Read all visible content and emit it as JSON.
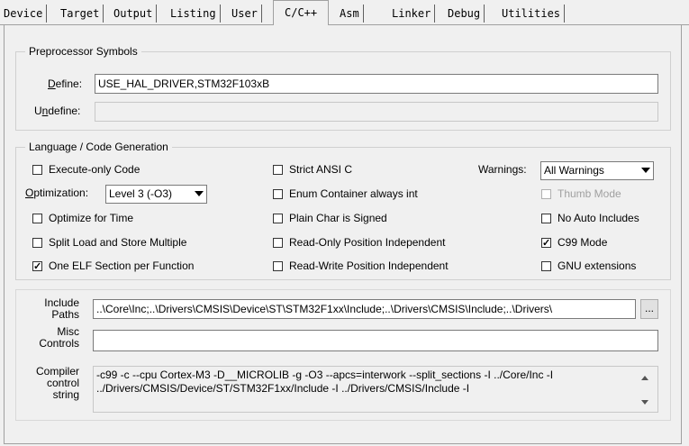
{
  "tabs": [
    "Device",
    "Target",
    "Output",
    "Listing",
    "User",
    "C/C++",
    "Asm",
    "Linker",
    "Debug",
    "Utilities"
  ],
  "active_tab": "C/C++",
  "preprocessor": {
    "legend": "Preprocessor Symbols",
    "define_label": "Define:",
    "define_value": "USE_HAL_DRIVER,STM32F103xB",
    "undefine_label": "Undefine:",
    "undefine_value": ""
  },
  "language": {
    "legend": "Language / Code Generation",
    "execute_only": {
      "label": "Execute-only Code",
      "checked": false
    },
    "optimization_label": "Optimization:",
    "optimization_value": "Level 3 (-O3)",
    "optimize_time": {
      "label": "Optimize for Time",
      "checked": false
    },
    "split_load": {
      "label": "Split Load and Store Multiple",
      "checked": false
    },
    "one_elf": {
      "label": "One ELF Section per Function",
      "checked": true
    },
    "strict_ansi": {
      "label": "Strict ANSI C",
      "checked": false
    },
    "enum_container": {
      "label": "Enum Container always int",
      "checked": false
    },
    "plain_char": {
      "label": "Plain Char is Signed",
      "checked": false
    },
    "ropi": {
      "label": "Read-Only Position Independent",
      "checked": false
    },
    "rwpi": {
      "label": "Read-Write Position Independent",
      "checked": false
    },
    "warnings_label": "Warnings:",
    "warnings_value": "All Warnings",
    "thumb_mode": {
      "label": "Thumb Mode",
      "checked": false,
      "disabled": true
    },
    "no_auto_includes": {
      "label": "No Auto Includes",
      "checked": false
    },
    "c99_mode": {
      "label": "C99 Mode",
      "checked": true
    },
    "gnu_extensions": {
      "label": "GNU extensions",
      "checked": false
    }
  },
  "include_paths": {
    "label_line1": "Include",
    "label_line2": "Paths",
    "value": "..\\Core\\Inc;..\\Drivers\\CMSIS\\Device\\ST\\STM32F1xx\\Include;..\\Drivers\\CMSIS\\Include;..\\Drivers\\",
    "browse_label": "..."
  },
  "misc_controls": {
    "label_line1": "Misc",
    "label_line2": "Controls",
    "value": ""
  },
  "compiler_string": {
    "label_line1": "Compiler",
    "label_line2": "control",
    "label_line3": "string",
    "line1": "-c99 -c --cpu Cortex-M3 -D__MICROLIB -g -O3 --apcs=interwork --split_sections -I ../Core/Inc -I",
    "line2": "../Drivers/CMSIS/Device/ST/STM32F1xx/Include -I ../Drivers/CMSIS/Include -I"
  }
}
